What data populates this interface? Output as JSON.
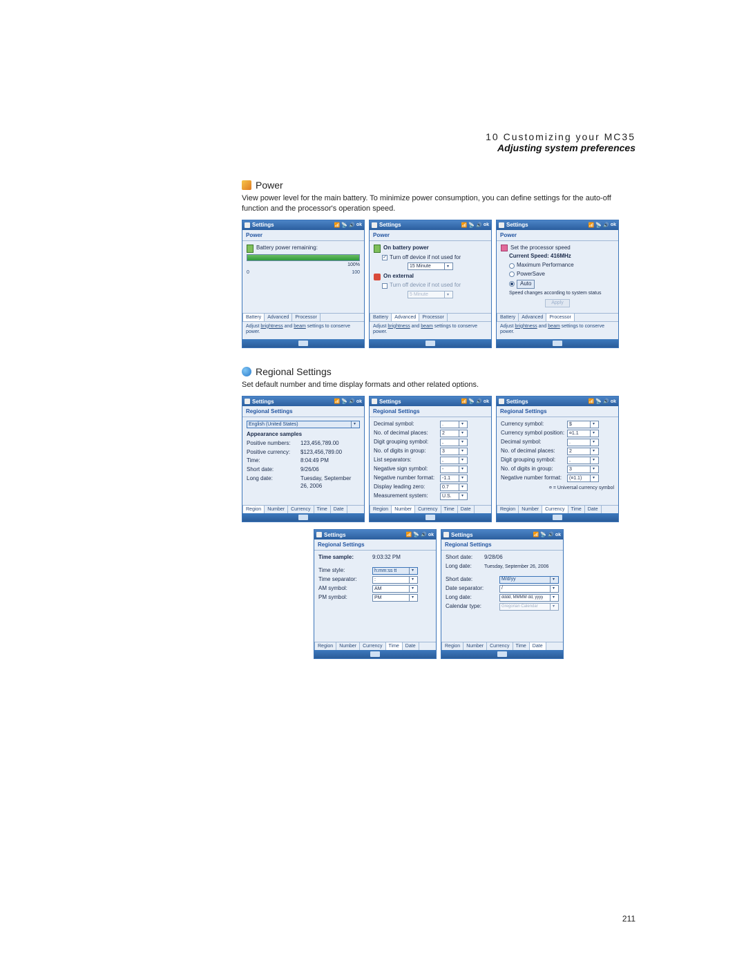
{
  "page": {
    "chapter": "10 Customizing your MC35",
    "subtitle": "Adjusting system preferences",
    "page_number": "211"
  },
  "power": {
    "heading": "Power",
    "desc": "View power level for the main battery. To minimize power consumption, you can define settings for the auto-off function and the processor's operation speed.",
    "hint_pre": "Adjust ",
    "hint_mid_a": "brightness",
    "hint_and": " and ",
    "hint_mid_b": "beam",
    "hint_post": " settings to conserve power.",
    "title": "Settings",
    "screen_name": "Power",
    "tabs": [
      "Battery",
      "Advanced",
      "Processor"
    ],
    "battery": {
      "label": "Battery power remaining:",
      "percent": "100%",
      "scale_lo": "0",
      "scale_hi": "100"
    },
    "advanced": {
      "on_battery": "On battery power",
      "chk1": "Turn off device if not used for",
      "minutes": "15 Minute",
      "on_external": "On external",
      "chk2": "Turn off device if not used for",
      "ext_minutes": "5 Minute"
    },
    "processor": {
      "set": "Set the processor speed",
      "cur": "Current Speed: 416MHz",
      "opt_max": "Maximum Performance",
      "opt_save": "PowerSave",
      "opt_auto": "Auto",
      "note": "Speed changes according to system status",
      "apply": "Apply"
    }
  },
  "regional": {
    "heading": "Regional Settings",
    "desc": "Set default number and time display formats and other related options.",
    "title": "Settings",
    "screen_name": "Regional Settings",
    "tabs": [
      "Region",
      "Number",
      "Currency",
      "Time",
      "Date"
    ],
    "region": {
      "select": "English (United States)",
      "samples": "Appearance samples",
      "pos_num_l": "Positive numbers:",
      "pos_num_v": "123,456,789.00",
      "pos_cur_l": "Positive currency:",
      "pos_cur_v": "$123,456,789.00",
      "time_l": "Time:",
      "time_v": "8:04:49 PM",
      "sd_l": "Short date:",
      "sd_v": "9/26/06",
      "ld_l": "Long date:",
      "ld_v": "Tuesday, September 26, 2006"
    },
    "number": {
      "dec_sym": "Decimal symbol:",
      "dec_places": "No. of decimal places:",
      "grp_sym": "Digit grouping symbol:",
      "digits_grp": "No. of digits in group:",
      "list_sep": "List separators:",
      "neg_sign": "Negative sign symbol:",
      "neg_fmt": "Negative number format:",
      "lead_zero": "Display leading zero:",
      "meas": "Measurement system:",
      "v_dec_sym": ".",
      "v_dec_places": "2",
      "v_grp_sym": ",",
      "v_digits_grp": "3",
      "v_list_sep": ",",
      "v_neg_sign": "-",
      "v_neg_fmt": "-1.1",
      "v_lead_zero": "0.7",
      "v_meas": "U.S."
    },
    "currency": {
      "sym": "Currency symbol:",
      "sym_pos": "Currency symbol position:",
      "dec_sym": "Decimal symbol:",
      "dec_places": "No. of decimal places:",
      "grp_sym": "Digit grouping symbol:",
      "digits_grp": "No. of digits in group:",
      "neg_fmt": "Negative number format:",
      "note": "¤ = Universal currency symbol",
      "v_sym": "$",
      "v_sym_pos": "¤1.1",
      "v_dec_sym": ".",
      "v_dec_places": "2",
      "v_grp_sym": ",",
      "v_digits_grp": "3",
      "v_neg_fmt": "(¤1.1)"
    },
    "time": {
      "sample_l": "Time sample:",
      "sample_v": "9:03:32 PM",
      "style_l": "Time style:",
      "style_v": "h:mm:ss tt",
      "sep_l": "Time separator:",
      "sep_v": ":",
      "am_l": "AM symbol:",
      "am_v": "AM",
      "pm_l": "PM symbol:",
      "pm_v": "PM"
    },
    "date": {
      "sd_l": "Short date:",
      "sd_v": "9/28/06",
      "ld_l": "Long date:",
      "ld_v": "Tuesday, September 26, 2006",
      "sdf_l": "Short date:",
      "sdf_v": "M/d/yy",
      "dsep_l": "Date separator:",
      "dsep_v": "/",
      "ldf_l": "Long date:",
      "ldf_v": "dddd, MMMM dd, yyyy",
      "cal_l": "Calendar type:",
      "cal_v": "Gregorian Calendar"
    }
  }
}
